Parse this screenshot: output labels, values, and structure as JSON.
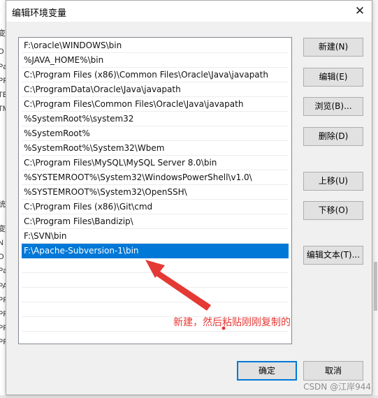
{
  "dialog": {
    "title": "编辑环境变量",
    "close_glyph": "✕"
  },
  "background": {
    "left_edge_chars": [
      "-",
      "变",
      "O",
      "Pa",
      "PF",
      "TE",
      "TM",
      "",
      "",
      "",
      "",
      "统",
      "",
      "变",
      "N",
      "O",
      "Pa",
      "PA",
      "PF",
      "PF",
      "PF",
      "PF"
    ]
  },
  "list": {
    "items": [
      "F:\\oracle\\WINDOWS\\bin",
      "%JAVA_HOME%\\bin",
      "C:\\Program Files (x86)\\Common Files\\Oracle\\Java\\javapath",
      "C:\\ProgramData\\Oracle\\Java\\javapath",
      "C:\\Program Files\\Common Files\\Oracle\\Java\\javapath",
      "%SystemRoot%\\system32",
      "%SystemRoot%",
      "%SystemRoot%\\System32\\Wbem",
      "C:\\Program Files\\MySQL\\MySQL Server 8.0\\bin",
      "%SYSTEMROOT%\\System32\\WindowsPowerShell\\v1.0\\",
      "%SYSTEMROOT%\\System32\\OpenSSH\\",
      "C:\\Program Files (x86)\\Git\\cmd",
      "C:\\Program Files\\Bandizip\\",
      "F:\\SVN\\bin",
      "F:\\Apache-Subversion-1\\bin"
    ],
    "selected_index": 14,
    "empty_rows": 6
  },
  "buttons": {
    "new": "新建(N)",
    "edit": "编辑(E)",
    "browse": "浏览(B)...",
    "delete": "删除(D)",
    "move_up": "上移(U)",
    "move_down": "下移(O)",
    "edit_text": "编辑文本(T)...",
    "ok": "确定",
    "cancel": "取消"
  },
  "annotation": {
    "text": "新建，然后粘贴刚刚复制的",
    "color": "#e53935"
  },
  "watermark": "CSDN @江岸944"
}
